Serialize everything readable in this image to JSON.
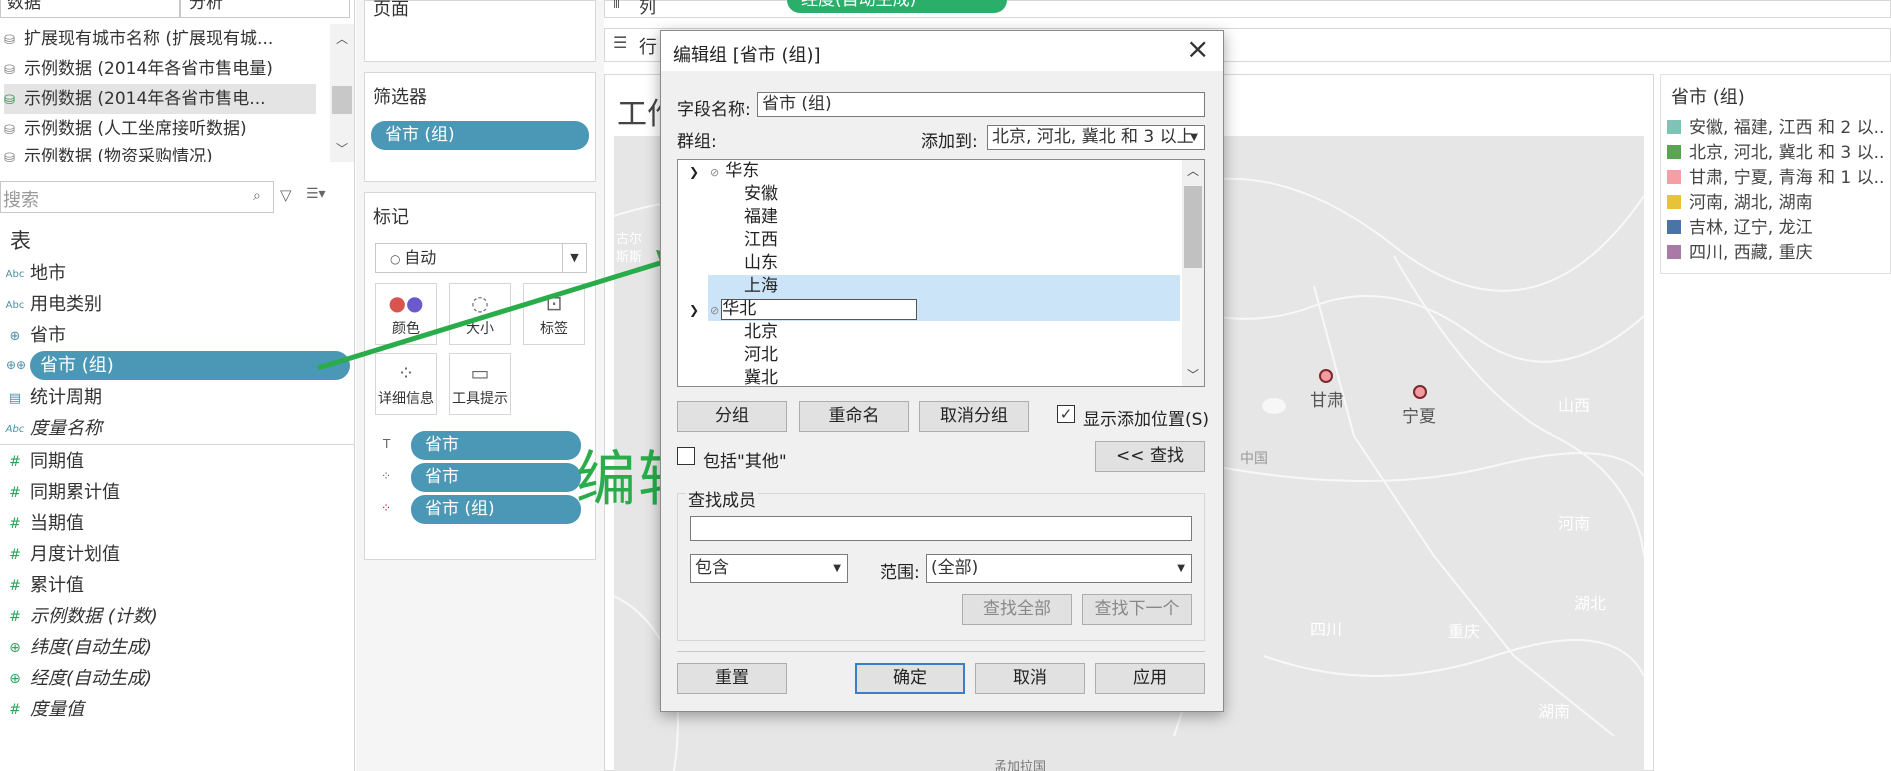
{
  "left_pane": {
    "tabs": [
      "数据",
      "分析"
    ],
    "datasources": [
      {
        "label": "扩展现有城市名称 (扩展现有城..."
      },
      {
        "label": "示例数据 (2014年各省市售电量)"
      },
      {
        "label": "示例数据 (2014年各省市售电..."
      },
      {
        "label": "示例数据 (人工坐席接听数据)"
      },
      {
        "label": "示例数据 (物资采购情况)"
      }
    ],
    "search_placeholder": "搜索",
    "tables_heading": "表",
    "dimensions": [
      {
        "label": "地市",
        "icon": "abc-icon"
      },
      {
        "label": "用电类别",
        "icon": "abc-icon"
      },
      {
        "label": "省市",
        "icon": "globe-icon"
      },
      {
        "label": "省市 (组)",
        "icon": "group-icon"
      },
      {
        "label": "统计周期",
        "icon": "calendar-icon"
      },
      {
        "label": "度量名称",
        "icon": "abc-icon"
      }
    ],
    "measures": [
      {
        "label": "同期值"
      },
      {
        "label": "同期累计值"
      },
      {
        "label": "当期值"
      },
      {
        "label": "月度计划值"
      },
      {
        "label": "累计值"
      },
      {
        "label": "示例数据 (计数)"
      },
      {
        "label": "纬度(自动生成)"
      },
      {
        "label": "经度(自动生成)"
      },
      {
        "label": "度量值"
      }
    ]
  },
  "shelves": {
    "pages_title": "页面",
    "filters_title": "筛选器",
    "filter_pill": "省市 (组)",
    "marks_title": "标记",
    "mark_type": "自动",
    "mark_buttons": [
      "颜色",
      "大小",
      "标签",
      "详细信息",
      "工具提示"
    ],
    "mark_pills": [
      "省市",
      "省市",
      "省市 (组)"
    ],
    "columns_label": "列",
    "columns_pill": "经度(自动生成)",
    "rows_label": "行",
    "sheet_title": "工作"
  },
  "map": {
    "labels": [
      "甘肃",
      "宁夏",
      "中国"
    ],
    "faint_labels": [
      "山西",
      "河南",
      "湖北",
      "四川",
      "重庆",
      "湖南"
    ],
    "partial_labels": [
      "古尔",
      "斯斯",
      "孟加拉国"
    ]
  },
  "legend": {
    "title": "省市 (组)",
    "items": [
      {
        "label": "安徽, 福建, 江西 和 2 以..",
        "color": "#7ec3b6"
      },
      {
        "label": "北京, 河北, 冀北 和 3 以..",
        "color": "#5aa454"
      },
      {
        "label": "甘肃, 宁夏, 青海 和 1 以..",
        "color": "#f49ea5"
      },
      {
        "label": "河南, 湖北, 湖南",
        "color": "#e8c23a"
      },
      {
        "label": "吉林, 辽宁, 龙江",
        "color": "#4a74a8"
      },
      {
        "label": "四川, 西藏, 重庆",
        "color": "#a97aa5"
      }
    ]
  },
  "annotation": {
    "text": "编辑分组",
    "color": "#2aac4a"
  },
  "dialog": {
    "title": "编辑组 [省市 (组)]",
    "field_name_label": "字段名称:",
    "field_name_value": "省市 (组)",
    "groups_label": "群组:",
    "add_to_label": "添加到:",
    "add_to_value": "北京, 河北, 冀北 和 3 以上",
    "tree": [
      {
        "label": "华东",
        "level": 0,
        "expanded": true
      },
      {
        "label": "安徽",
        "level": 1
      },
      {
        "label": "福建",
        "level": 1
      },
      {
        "label": "江西",
        "level": 1
      },
      {
        "label": "山东",
        "level": 1
      },
      {
        "label": "上海",
        "level": 1,
        "highlighted": true
      },
      {
        "label": "华北",
        "level": 0,
        "expanded": true,
        "editing": true
      },
      {
        "label": "北京",
        "level": 1
      },
      {
        "label": "河北",
        "level": 1
      },
      {
        "label": "冀北",
        "level": 1
      }
    ],
    "buttons": {
      "group": "分组",
      "rename": "重命名",
      "ungroup": "取消分组",
      "show_add_location": "显示添加位置(S)",
      "include_other": "包括\"其他\"",
      "find_toggle": "<< 查找",
      "reset": "重置",
      "ok": "确定",
      "cancel": "取消",
      "apply": "应用"
    },
    "find": {
      "title": "查找成员",
      "query": "",
      "mode": "包含",
      "scope_label": "范围:",
      "scope_value": "(全部)",
      "find_all": "查找全部",
      "find_next": "查找下一个"
    },
    "show_add_location_checked": true,
    "include_other_checked": false
  }
}
